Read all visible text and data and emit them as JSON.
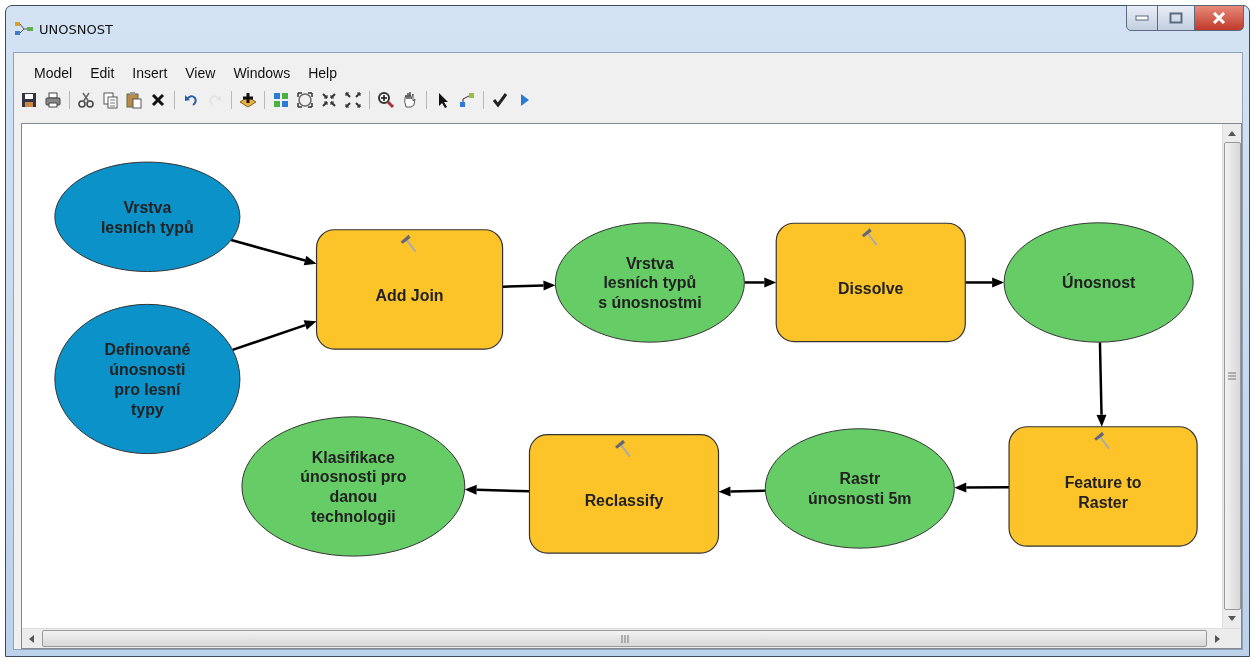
{
  "window": {
    "title": "UNOSNOST"
  },
  "menu": [
    "Model",
    "Edit",
    "Insert",
    "View",
    "Windows",
    "Help"
  ],
  "toolbar": [
    {
      "kind": "save",
      "disabled": false
    },
    {
      "kind": "print",
      "disabled": false
    },
    {
      "kind": "sep"
    },
    {
      "kind": "cut",
      "disabled": false
    },
    {
      "kind": "copy",
      "disabled": false
    },
    {
      "kind": "paste",
      "disabled": false
    },
    {
      "kind": "delete",
      "disabled": false
    },
    {
      "kind": "sep"
    },
    {
      "kind": "undo",
      "disabled": false
    },
    {
      "kind": "redo",
      "disabled": true
    },
    {
      "kind": "sep"
    },
    {
      "kind": "add",
      "disabled": false
    },
    {
      "kind": "sep"
    },
    {
      "kind": "layout",
      "disabled": false
    },
    {
      "kind": "extent",
      "disabled": false
    },
    {
      "kind": "zoomin",
      "disabled": false
    },
    {
      "kind": "zoomout",
      "disabled": false
    },
    {
      "kind": "sep"
    },
    {
      "kind": "zoom",
      "disabled": false
    },
    {
      "kind": "pan",
      "disabled": false
    },
    {
      "kind": "sep"
    },
    {
      "kind": "select",
      "disabled": false
    },
    {
      "kind": "connect",
      "disabled": false
    },
    {
      "kind": "sep"
    },
    {
      "kind": "validate",
      "disabled": false
    },
    {
      "kind": "run",
      "disabled": false
    }
  ],
  "nodes": [
    {
      "kind": "input",
      "lines": [
        "Vrstva",
        "lesních typů"
      ]
    },
    {
      "kind": "input",
      "lines": [
        "Definované",
        "únosnosti",
        "pro lesní",
        "typy"
      ]
    },
    {
      "kind": "tool",
      "lines": [
        "Add Join"
      ]
    },
    {
      "kind": "derived",
      "lines": [
        "Vrstva",
        "lesních typů",
        "s únosnostmi"
      ]
    },
    {
      "kind": "tool",
      "lines": [
        "Dissolve"
      ]
    },
    {
      "kind": "derived",
      "lines": [
        "Únosnost"
      ]
    },
    {
      "kind": "derived",
      "lines": [
        "Klasifikace",
        "únosnosti pro",
        "danou",
        "technologii"
      ]
    },
    {
      "kind": "tool",
      "lines": [
        "Reclassify"
      ]
    },
    {
      "kind": "derived",
      "lines": [
        "Rastr",
        "únosnosti 5m"
      ]
    },
    {
      "kind": "tool",
      "lines": [
        "Feature to",
        "Raster"
      ]
    }
  ]
}
